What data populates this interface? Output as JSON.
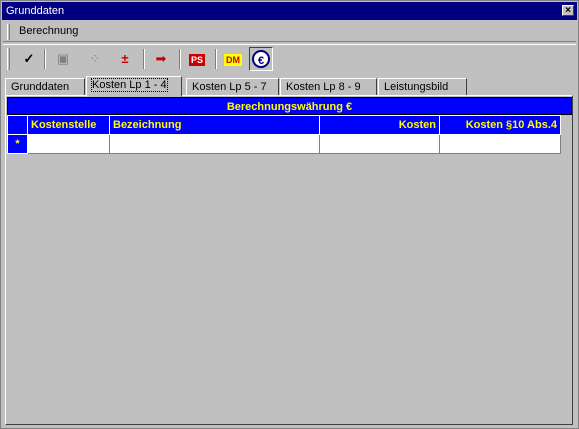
{
  "window": {
    "title": "Grunddaten",
    "close_label": "×"
  },
  "menubar": {
    "items": [
      "Berechnung"
    ]
  },
  "toolbar": {
    "buttons": [
      {
        "name": "check-icon",
        "glyph": "✓",
        "color": "#000000"
      },
      {
        "name": "document-icon",
        "glyph": "▣",
        "color": "#808080"
      },
      {
        "name": "copy-icon",
        "glyph": "⁘",
        "color": "#808080"
      },
      {
        "name": "plus-minus-icon",
        "glyph": "±",
        "color": "#cc0000"
      },
      {
        "name": "exit-arrow-icon",
        "glyph": "➡",
        "color": "#cc0000"
      },
      {
        "name": "ps-icon",
        "glyph": "PS",
        "color": "#cc0000"
      },
      {
        "name": "dm-currency-icon",
        "glyph": "DM",
        "color": "#cc0000"
      },
      {
        "name": "euro-currency-icon",
        "glyph": "€",
        "color": "#000080"
      }
    ]
  },
  "tabs": [
    {
      "label": "Grunddaten",
      "active": false
    },
    {
      "label": "Kosten Lp 1 - 4",
      "active": true
    },
    {
      "label": "Kosten Lp 5 - 7",
      "active": false
    },
    {
      "label": "Kosten Lp 8 - 9",
      "active": false
    },
    {
      "label": "Leistungsbild",
      "active": false
    }
  ],
  "grid": {
    "currency_header": "Berechnungswährung €",
    "columns": [
      "Kostenstelle",
      "Bezeichnung",
      "Kosten",
      "Kosten §10 Abs.4"
    ],
    "new_row_indicator": "*",
    "rows": []
  },
  "colors": {
    "header_bg": "#0000ff",
    "header_text": "#ffff00",
    "title_bg": "#000080"
  }
}
